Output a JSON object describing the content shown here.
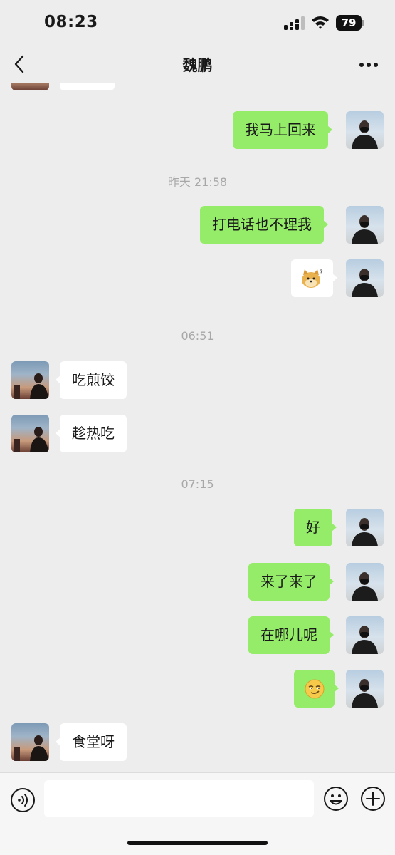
{
  "status_bar": {
    "time": "08:23",
    "battery": "79"
  },
  "header": {
    "title": "魏鹏"
  },
  "messages": {
    "m1": "我马上回来",
    "t1": "昨天 21:58",
    "m2": "打电话也不理我",
    "t2": "06:51",
    "m4": "吃煎饺",
    "m5": "趁热吃",
    "t3": "07:15",
    "m6": "好",
    "m7": "来了来了",
    "m8": "在哪儿呢",
    "m9": "😏",
    "m10": "食堂呀"
  },
  "input": {
    "placeholder": ""
  },
  "colors": {
    "my_bubble": "#95ec69",
    "their_bubble": "#ffffff",
    "background": "#ededed"
  }
}
